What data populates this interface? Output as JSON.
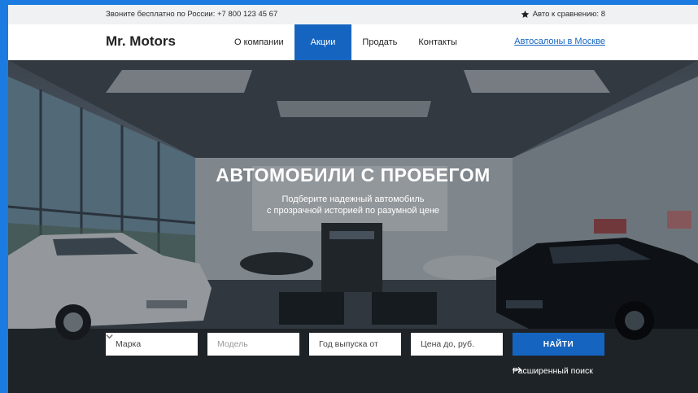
{
  "topbar": {
    "phone_label": "Звоните бесплатно по России: ",
    "phone_number": "+7 800 123 45 67",
    "compare_label": "Авто к сравнению: 8",
    "compare_icon": "star-icon"
  },
  "header": {
    "logo": "Mr. Motors",
    "nav": [
      {
        "label": "О компании",
        "active": false
      },
      {
        "label": "Акции",
        "active": true
      },
      {
        "label": "Продать",
        "active": false
      },
      {
        "label": "Контакты",
        "active": false
      }
    ],
    "dealers_link": "Автосалоны в Москве"
  },
  "hero": {
    "title": "АВТОМОБИЛИ С ПРОБЕГОМ",
    "subtitle_line1": "Подберите надежный автомобиль",
    "subtitle_line2": "с прозрачной историей по разумной цене"
  },
  "filters": {
    "brand": "Марка",
    "model": "Модель",
    "year_from": "Год выпуска от",
    "price_to": "Цена до, руб.",
    "find_button": "НАЙТИ",
    "advanced_search": "Расширенный поиск"
  },
  "colors": {
    "accent": "#1565c0",
    "page_bg": "#1c7be0",
    "topbar_bg": "#f0f1f3"
  }
}
